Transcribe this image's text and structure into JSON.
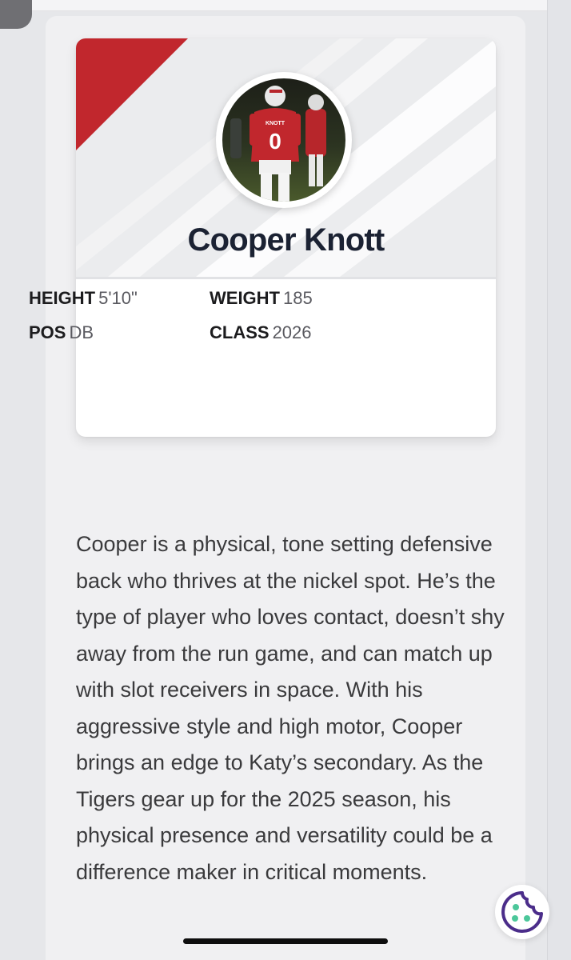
{
  "player": {
    "name": "Cooper Knott",
    "photo_alt": "Cooper Knott on the field in jersey number 0",
    "jersey_text": "KNOTT",
    "jersey_number": "0"
  },
  "stats": {
    "height_label": "HEIGHT",
    "height_value": "5'10\"",
    "weight_label": "WEIGHT",
    "weight_value": "185",
    "pos_label": "POS",
    "pos_value": "DB",
    "class_label": "CLASS",
    "class_value": "2026"
  },
  "bio": "Cooper is a physical, tone setting defensive back who thrives at the nickel spot. He’s the type of player who loves contact, doesn’t shy away from the run game, and can match up with slot receivers in space. With his aggressive style and high motor, Cooper brings an edge to Katy’s secondary. As the Tigers gear up for the 2025 season, his physical presence and versatility could be a difference maker in critical moments.",
  "icons": {
    "cookie": "cookie-icon",
    "corner_tab": "back-tab"
  },
  "colors": {
    "accent_red": "#c1272d",
    "name_text": "#1b2233",
    "cookie_purple": "#4b2d8a",
    "cookie_green": "#4cc79a"
  }
}
